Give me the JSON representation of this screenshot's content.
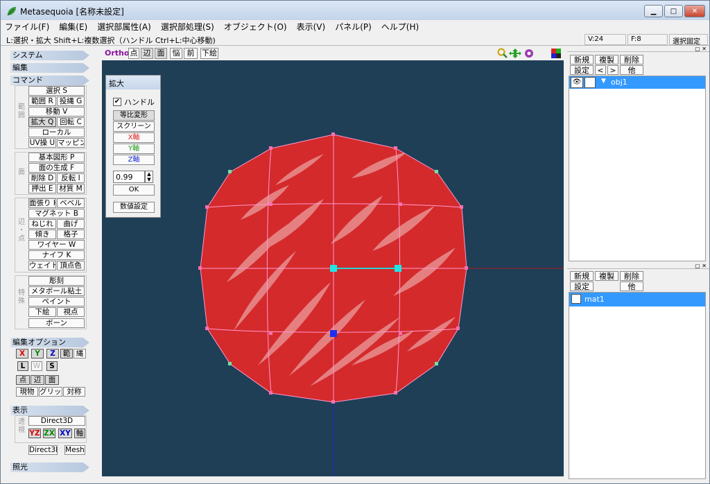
{
  "window": {
    "title": "Metasequoia [名称未設定]",
    "minimize": "▁",
    "maximize": "□",
    "close": "✕"
  },
  "menu": [
    "ファイル(F)",
    "編集(E)",
    "選択部属性(A)",
    "選択部処理(S)",
    "オブジェクト(O)",
    "表示(V)",
    "パネル(P)",
    "ヘルプ(H)"
  ],
  "status": {
    "hint": "L:選択・拡大  Shift+L:複数選択（ハンドル  Ctrl+L:中心移動)",
    "vertices": "V:24",
    "faces": "F:8",
    "lock": "選択固定"
  },
  "left": {
    "sections": {
      "system": "システム",
      "edit": "編集",
      "command": "コマンド",
      "edit_option": "編集オプション",
      "display": "表示",
      "lighting": "照光"
    },
    "group_labels": {
      "select": "範囲",
      "face": "面",
      "edge": "辺・点",
      "special": "特殊",
      "view": "透視"
    },
    "cmd": {
      "select": "選択 S",
      "range": "範囲 R",
      "lasso": "投縄 G",
      "move": "移動 V",
      "scale": "拡大 Q",
      "rotate": "回転 C",
      "local": "ローカル",
      "uv": "UV操 U",
      "mapping": "マッピング",
      "basic": "基本図形 P",
      "face_gen": "面の生成 F",
      "delete": "削除 D",
      "flip": "反転 I",
      "extrude": "押出 E",
      "material": "材質 M",
      "face_stretch": "面張り H",
      "bevel": "ベベル",
      "magnet": "マグネット B",
      "twist": "ねじれ",
      "bend": "曲げ",
      "tilt": "傾き",
      "lattice": "格子",
      "wire": "ワイヤー W",
      "knife": "ナイフ K",
      "weight": "ウェイト",
      "vcolor": "頂点色",
      "sculpt": "彫刻",
      "metaball": "メタボール粘土",
      "paint": "ペイント",
      "underlay": "下絵",
      "viewpoint": "視点",
      "bone": "ボーン"
    },
    "options": {
      "x": "X",
      "y": "Y",
      "z": "Z",
      "range": "範",
      "lasso": "縄",
      "l": "L",
      "w": "W",
      "s": "S",
      "point": "点",
      "edge": "辺",
      "face": "面",
      "current": "現物",
      "grid": "グリッド",
      "symmetry": "対称"
    },
    "display": {
      "d3d": "Direct3D",
      "yz": "YZ",
      "zx": "ZX",
      "xy": "XY",
      "axis": "軸",
      "d3d2": "Direct3D",
      "mesh": "Mesh"
    }
  },
  "viewtools": {
    "ortho": "Ortho",
    "point": "点",
    "edge": "辺",
    "face": "面",
    "transparent": "悩",
    "front": "前",
    "underlay": "下絵"
  },
  "dialog": {
    "title": "拡大",
    "handle": "ハンドル",
    "uniform": "等比変形",
    "screen": "スクリーン",
    "x": "X軸",
    "y": "Y軸",
    "z": "Z軸",
    "value": "0.99",
    "ok": "OK",
    "numeric": "数値設定"
  },
  "objects": {
    "new": "新規",
    "copy": "複製",
    "delete": "削除",
    "settings": "設定",
    "prev": "<",
    "next": ">",
    "other": "他",
    "item": "obj1"
  },
  "materials": {
    "new": "新規",
    "copy": "複製",
    "delete": "削除",
    "settings": "設定",
    "other": "他",
    "item": "mat1"
  },
  "colors": {
    "viewport": "#1f3f57",
    "mesh": "#d42a2c",
    "accent": "#3399ff"
  }
}
